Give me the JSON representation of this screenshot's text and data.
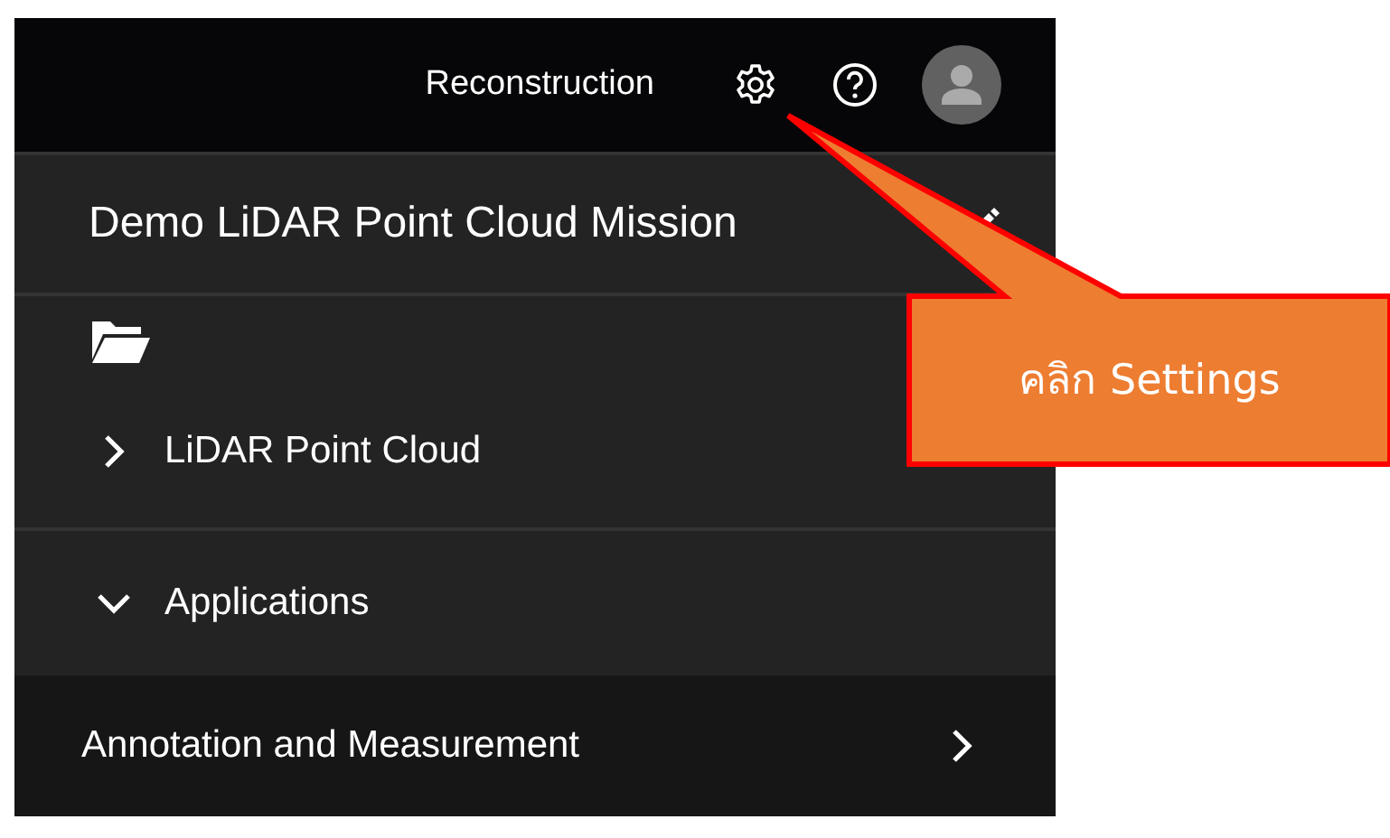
{
  "top_bar": {
    "title": "Reconstruction"
  },
  "mission": {
    "title": "Demo LiDAR Point Cloud Mission"
  },
  "sections": [
    {
      "label": "LiDAR Point Cloud",
      "expanded": false
    },
    {
      "label": "Applications",
      "expanded": true
    }
  ],
  "applications": [
    {
      "label": "Annotation and Measurement"
    }
  ],
  "callout": {
    "text": "คลิก Settings"
  }
}
